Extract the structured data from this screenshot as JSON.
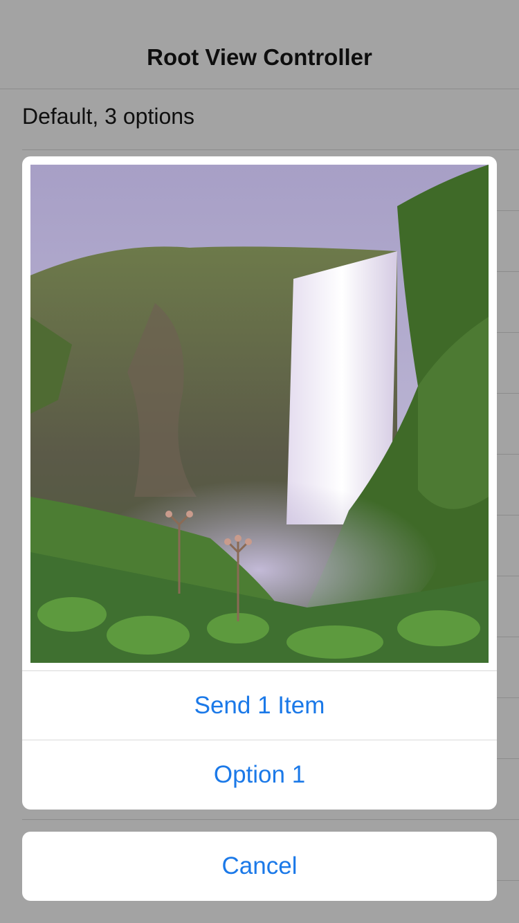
{
  "nav": {
    "title": "Root View Controller"
  },
  "table": {
    "rows": [
      {
        "label": "Default, 3 options"
      }
    ]
  },
  "sheet": {
    "image_subject": "waterfall-photo",
    "actions": [
      {
        "label": "Send 1 Item"
      },
      {
        "label": "Option 1"
      }
    ],
    "cancel_label": "Cancel"
  },
  "colors": {
    "dimmed_background": "#a3a3a3",
    "action_tint": "#1b79e8",
    "sheet_background": "#ffffff"
  }
}
